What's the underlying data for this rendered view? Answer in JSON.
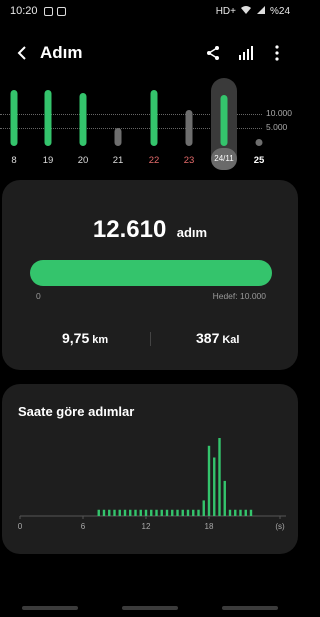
{
  "status_bar": {
    "time": "10:20",
    "network": "HD+",
    "battery": "%24"
  },
  "header": {
    "title": "Adım"
  },
  "icons": {
    "back": "arrow-left-icon",
    "share": "share-icon",
    "chart": "bar-chart-icon",
    "more": "more-vertical-icon"
  },
  "week": {
    "reference_lines": [
      "10.000",
      "5.000"
    ],
    "goal": 10000,
    "days": [
      {
        "label": "8",
        "steps": 11000,
        "reached": true
      },
      {
        "label": "19",
        "steps": 11000,
        "reached": true
      },
      {
        "label": "20",
        "steps": 10500,
        "reached": true
      },
      {
        "label": "21",
        "steps": 3500,
        "reached": false
      },
      {
        "label": "22",
        "steps": 11000,
        "reached": true,
        "weekend": true
      },
      {
        "label": "23",
        "steps": 7000,
        "reached": false,
        "weekend": true
      },
      {
        "label": "24/11",
        "steps": 10000,
        "reached": true,
        "selected": true
      },
      {
        "label": "25",
        "steps": 1200,
        "reached": false,
        "today": true
      }
    ]
  },
  "summary": {
    "steps": "12.610",
    "steps_unit": "adım",
    "progress_fraction": 1.0,
    "progress_min": "0",
    "goal_label": "Hedef: 10.000",
    "distance": "9,75",
    "distance_unit": "km",
    "calories": "387",
    "calories_unit": "Kal"
  },
  "hourly": {
    "title": "Saate göre adımlar",
    "x_ticks": [
      "0",
      "6",
      "12",
      "18",
      "(s)"
    ]
  },
  "chart_data": {
    "type": "bar",
    "title": "Saate göre adımlar",
    "xlabel": "(s)",
    "ylabel": "",
    "x_ticks": [
      "0",
      "6",
      "12",
      "18"
    ],
    "xlim": [
      0,
      24
    ],
    "ylim": [
      0,
      100
    ],
    "bars": [
      {
        "x": 7.5,
        "y": 8
      },
      {
        "x": 8.0,
        "y": 8
      },
      {
        "x": 8.5,
        "y": 8
      },
      {
        "x": 9.0,
        "y": 8
      },
      {
        "x": 9.5,
        "y": 8
      },
      {
        "x": 10.0,
        "y": 8
      },
      {
        "x": 10.5,
        "y": 8
      },
      {
        "x": 11.0,
        "y": 8
      },
      {
        "x": 11.5,
        "y": 8
      },
      {
        "x": 12.0,
        "y": 8
      },
      {
        "x": 12.5,
        "y": 8
      },
      {
        "x": 13.0,
        "y": 8
      },
      {
        "x": 13.5,
        "y": 8
      },
      {
        "x": 14.0,
        "y": 8
      },
      {
        "x": 14.5,
        "y": 8
      },
      {
        "x": 15.0,
        "y": 8
      },
      {
        "x": 15.5,
        "y": 8
      },
      {
        "x": 16.0,
        "y": 8
      },
      {
        "x": 16.5,
        "y": 8
      },
      {
        "x": 17.0,
        "y": 8
      },
      {
        "x": 17.5,
        "y": 20
      },
      {
        "x": 18.0,
        "y": 90
      },
      {
        "x": 18.5,
        "y": 75
      },
      {
        "x": 19.0,
        "y": 100
      },
      {
        "x": 19.5,
        "y": 45
      },
      {
        "x": 20.0,
        "y": 8
      },
      {
        "x": 20.5,
        "y": 8
      },
      {
        "x": 21.0,
        "y": 8
      },
      {
        "x": 21.5,
        "y": 8
      },
      {
        "x": 22.0,
        "y": 8
      }
    ]
  },
  "colors": {
    "accent": "#34c46c",
    "accent_dim": "#2aa85a",
    "bar_missed": "#6e6e6e",
    "weekend": "#e46b6b",
    "card": "#1e1e1e",
    "background": "#000000"
  }
}
